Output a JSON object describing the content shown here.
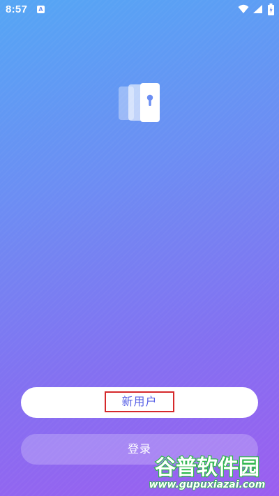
{
  "status_bar": {
    "time": "8:57",
    "notification_badge": "A",
    "icons": [
      "wifi-icon",
      "signal-icon",
      "battery-charging-icon"
    ]
  },
  "logo": {
    "icon": "vault-door-keyhole-icon"
  },
  "actions": {
    "new_user_label": "新用户",
    "login_label": "登录"
  },
  "watermark": {
    "brand": "谷普软件园",
    "url": "www.gupuxiazai.com"
  },
  "colors": {
    "gradient_top": "#55a6f4",
    "gradient_bottom": "#9c5ef0",
    "primary_text": "#5a62e6",
    "highlight_border": "#d5282b",
    "watermark_green": "#2db84b"
  }
}
